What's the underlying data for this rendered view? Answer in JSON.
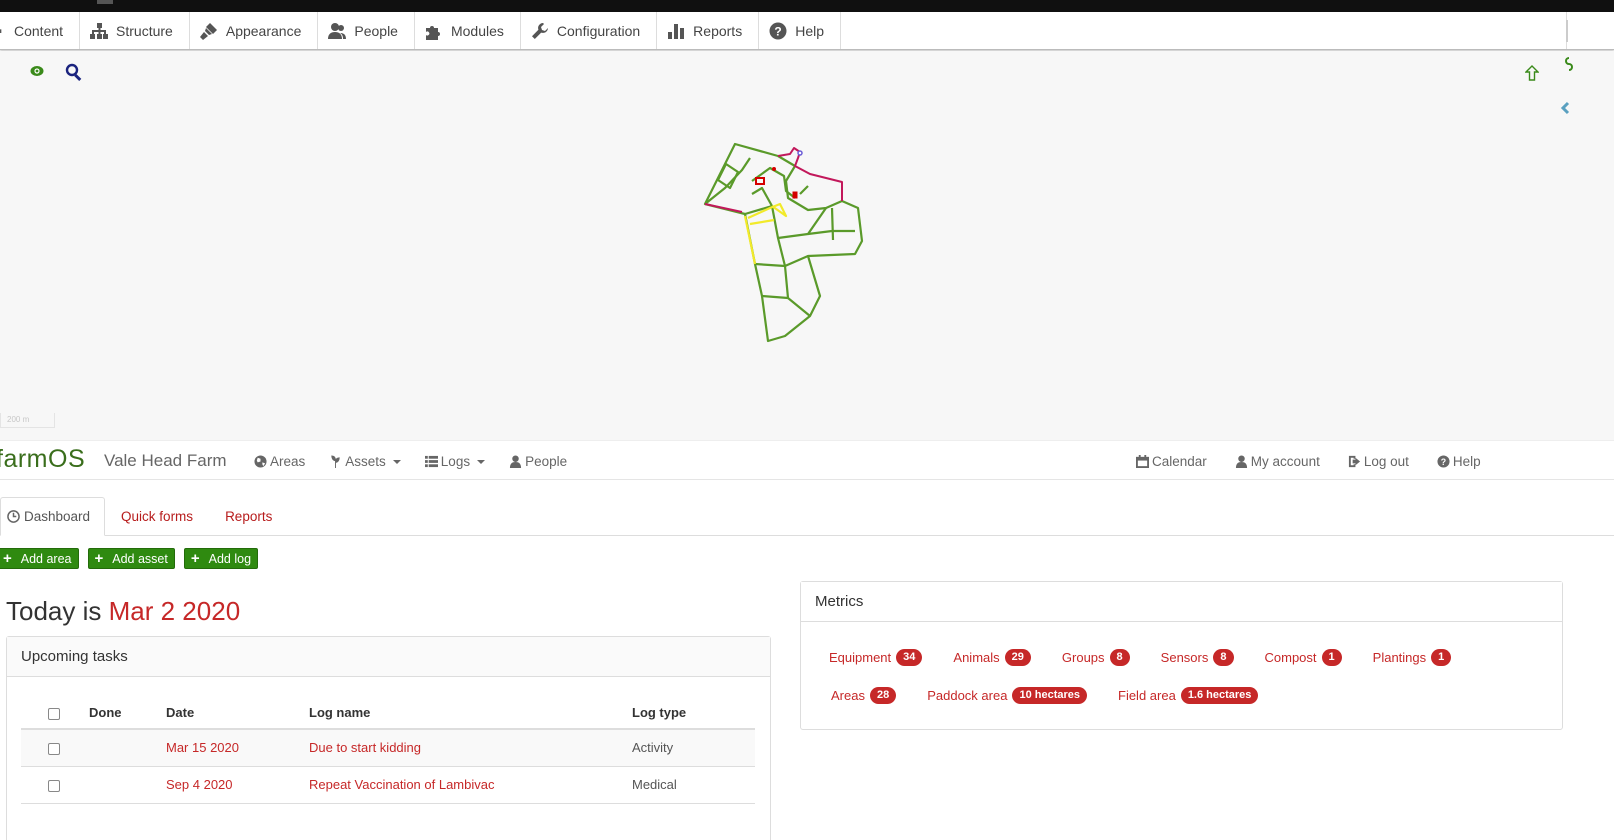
{
  "admin_menu": {
    "items": [
      {
        "label": "Content"
      },
      {
        "label": "Structure"
      },
      {
        "label": "Appearance"
      },
      {
        "label": "People"
      },
      {
        "label": "Modules"
      },
      {
        "label": "Configuration"
      },
      {
        "label": "Reports"
      },
      {
        "label": "Help"
      }
    ]
  },
  "map": {
    "scale_label": "200 m",
    "colors": {
      "field": "#5a9a2a",
      "highlight": "#f2ea2a",
      "boundary": "#c2185b",
      "marker": "#d50000"
    }
  },
  "farm_nav": {
    "brand": "farmOS",
    "site_name": "Vale Head Farm",
    "left_links": [
      "Areas",
      "Assets",
      "Logs",
      "People"
    ],
    "right_links": [
      "Calendar",
      "My account",
      "Log out",
      "Help"
    ]
  },
  "tabs": [
    "Dashboard",
    "Quick forms",
    "Reports"
  ],
  "actions": [
    "Add area",
    "Add asset",
    "Add log"
  ],
  "today": {
    "prefix": "Today is",
    "date": "Mar 2 2020"
  },
  "upcoming_tasks": {
    "title": "Upcoming tasks",
    "columns": [
      "Done",
      "Date",
      "Log name",
      "Log type"
    ],
    "rows": [
      {
        "date": "Mar 15 2020",
        "name": "Due to start kidding",
        "type": "Activity"
      },
      {
        "date": "Sep 4 2020",
        "name": "Repeat Vaccination of Lambivac",
        "type": "Medical"
      }
    ]
  },
  "metrics": {
    "title": "Metrics",
    "row1": [
      {
        "label": "Equipment",
        "value": "34"
      },
      {
        "label": "Animals",
        "value": "29"
      },
      {
        "label": "Groups",
        "value": "8"
      },
      {
        "label": "Sensors",
        "value": "8"
      },
      {
        "label": "Compost",
        "value": "1"
      },
      {
        "label": "Plantings",
        "value": "1"
      }
    ],
    "row2": [
      {
        "label": "Areas",
        "value": "28"
      },
      {
        "label": "Paddock area",
        "value": "10 hectares"
      },
      {
        "label": "Field area",
        "value": "1.6 hectares"
      }
    ]
  },
  "colors": {
    "accent": "#c62828",
    "brand": "#3a6e1c",
    "button": "#2f8a10"
  }
}
